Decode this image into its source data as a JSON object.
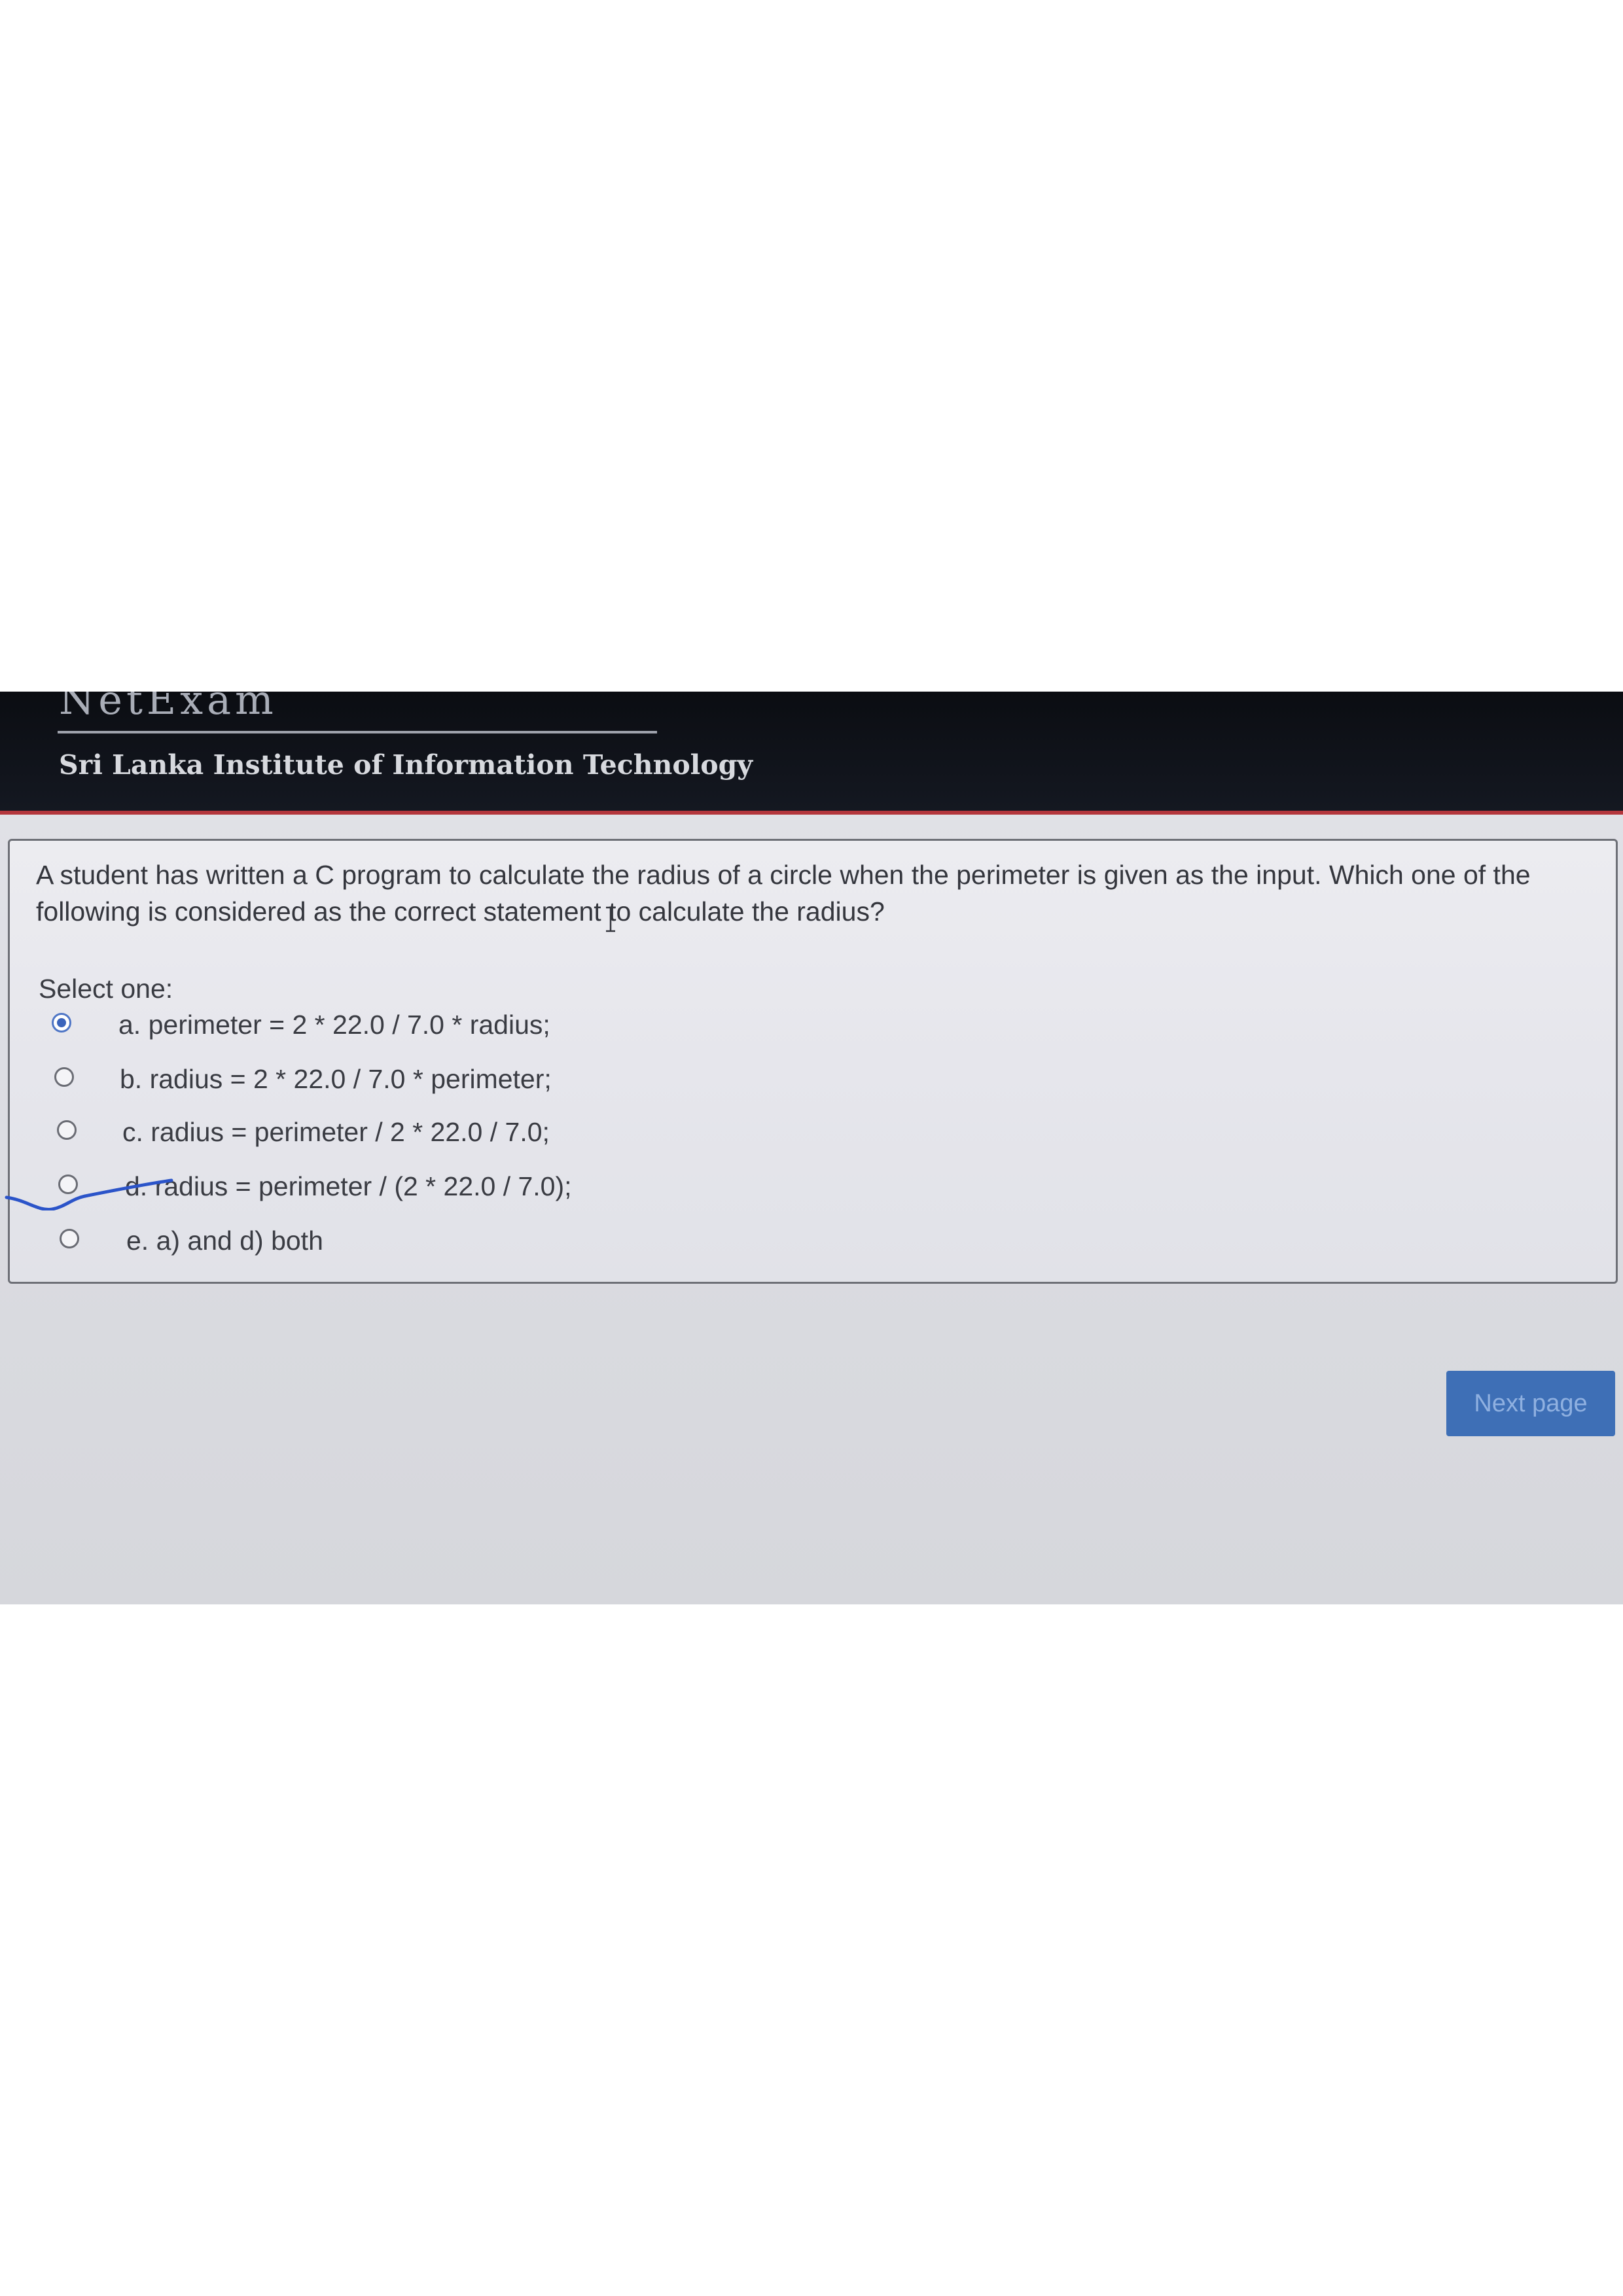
{
  "header": {
    "logo_text": "NetExam",
    "institute_name": "Sri Lanka Institute of Information Technology"
  },
  "quiz": {
    "question_text": "A student has written a C program to calculate the radius of a circle when the perimeter is given as the input. Which one of the following is considered as the correct statement to calculate the radius?",
    "select_label": "Select one:",
    "selected_option": "a",
    "options": [
      {
        "id": "a",
        "label": "a. perimeter = 2 * 22.0 / 7.0 * radius;"
      },
      {
        "id": "b",
        "label": "b. radius = 2 * 22.0 / 7.0 * perimeter;"
      },
      {
        "id": "c",
        "label": "c. radius = perimeter / 2 * 22.0 / 7.0;"
      },
      {
        "id": "d",
        "label": "d. radius = perimeter / (2 * 22.0 / 7.0);"
      },
      {
        "id": "e",
        "label": "e. a) and d) both"
      }
    ]
  },
  "navigation": {
    "next_label": "Next page"
  },
  "colors": {
    "header_bg": "#0b0d12",
    "header_accent": "#b3363c",
    "button_bg": "#3e6fb6",
    "radio_selected": "#3b64bb",
    "annotation_ink": "#2b54c9"
  }
}
